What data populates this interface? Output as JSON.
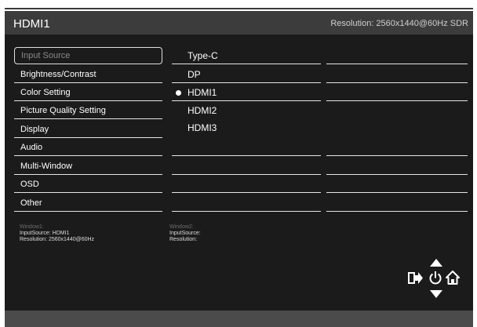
{
  "header": {
    "title": "HDMI1",
    "resolution": "Resolution: 2560x1440@60Hz SDR"
  },
  "menu": [
    {
      "label": "Input Source",
      "selected": true
    },
    {
      "label": "Brightness/Contrast"
    },
    {
      "label": "Color Setting"
    },
    {
      "label": "Picture Quality Setting"
    },
    {
      "label": "Display"
    },
    {
      "label": "Audio"
    },
    {
      "label": "Multi-Window"
    },
    {
      "label": "OSD"
    },
    {
      "label": "Other"
    }
  ],
  "inputs": [
    {
      "label": "Type-C"
    },
    {
      "label": "DP"
    },
    {
      "label": "HDMI1",
      "current": true
    },
    {
      "label": "HDMI2"
    },
    {
      "label": "HDMI3"
    }
  ],
  "window1": {
    "title": "Window1:",
    "source": "InputSource: HDMI1",
    "resolution": "Resolution: 2560x1440@60Hz"
  },
  "window2": {
    "title": "Window2:",
    "source": "InputSource:",
    "resolution": "Resolution:"
  },
  "icons": [
    "up-arrow-icon",
    "exit-icon",
    "power-icon",
    "home-icon",
    "down-arrow-icon"
  ],
  "colors": {
    "panel": "#1b1b1b",
    "header": "#3c3c3c",
    "footer": "#4b4b4b"
  }
}
